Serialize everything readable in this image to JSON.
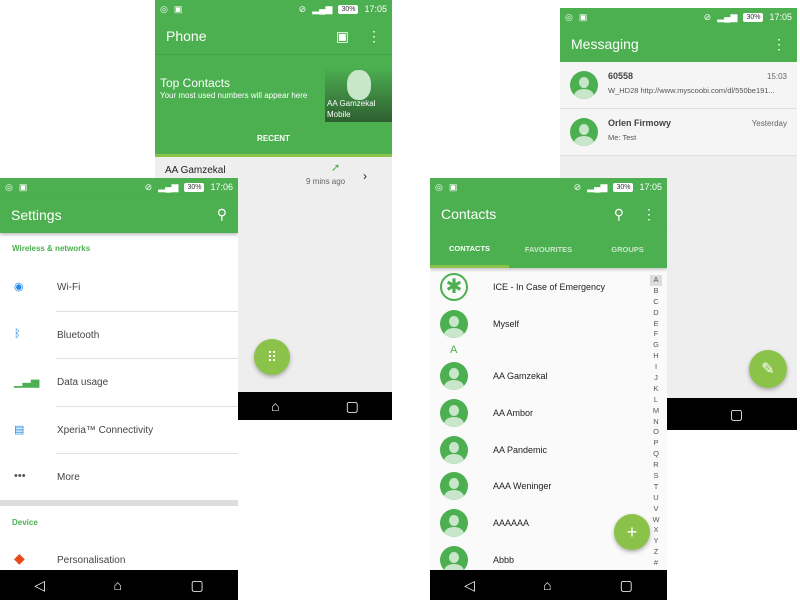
{
  "status": {
    "battery": "30%"
  },
  "phone": {
    "time": "17:05",
    "title": "Phone",
    "top_title": "Top Contacts",
    "top_sub": "Your most used numbers will appear here",
    "top_name": "AA  Gamzekal",
    "top_type": "Mobile",
    "tab": "RECENT",
    "recent": {
      "name": "AA  Gamzekal",
      "time": "9 mins ago"
    }
  },
  "settings": {
    "time": "17:06",
    "title": "Settings",
    "section1": "Wireless & networks",
    "items": [
      {
        "label": "Wi-Fi",
        "icon": "wifi-icon"
      },
      {
        "label": "Bluetooth",
        "icon": "bluetooth-icon"
      },
      {
        "label": "Data usage",
        "icon": "data-usage-icon"
      },
      {
        "label": "Xperia™ Connectivity",
        "icon": "xperia-connectivity-icon"
      },
      {
        "label": "More",
        "icon": "more-icon"
      }
    ],
    "section2": "Device",
    "device_item": "Personalisation"
  },
  "messaging": {
    "time": "17:05",
    "title": "Messaging",
    "threads": [
      {
        "name": "60558",
        "time": "15:03",
        "preview": "W_HD28 http://www.myscoobi.com/dl/550be191..."
      },
      {
        "name": "Orlen Firmowy",
        "time": "Yesterday",
        "preview": "Me: Test"
      }
    ]
  },
  "contacts": {
    "time": "17:05",
    "title": "Contacts",
    "tabs": [
      "CONTACTS",
      "FAVOURITES",
      "GROUPS"
    ],
    "active_tab": "CONTACTS",
    "ice": "ICE - In Case of Emergency",
    "myself": "Myself",
    "header": "A",
    "list": [
      "AA  Gamzekal",
      "AA Ambor",
      "AA Pandemic",
      "AAA Weninger",
      "AAAAAA",
      "Abbb"
    ],
    "index": [
      "A",
      "B",
      "C",
      "D",
      "E",
      "F",
      "G",
      "H",
      "I",
      "J",
      "K",
      "L",
      "M",
      "N",
      "O",
      "P",
      "Q",
      "R",
      "S",
      "T",
      "U",
      "V",
      "W",
      "X",
      "Y",
      "Z",
      "#"
    ]
  },
  "colors": {
    "primary": "#4caf50",
    "accent": "#8bc34a"
  }
}
